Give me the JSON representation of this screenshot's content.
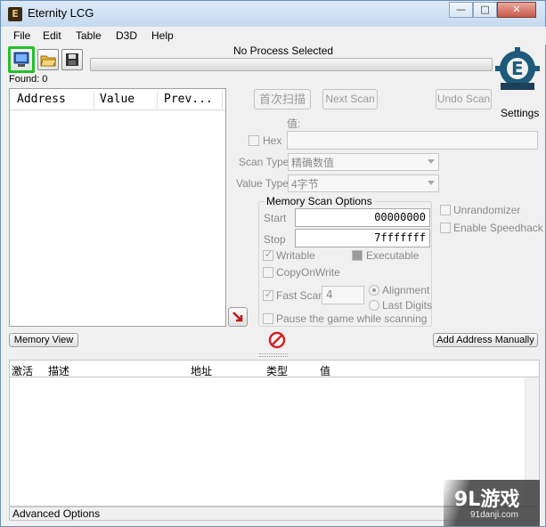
{
  "window": {
    "title": "Eternity LCG",
    "controls": {
      "minimize": "—",
      "maximize": "□",
      "close": "✕"
    }
  },
  "menu": [
    "File",
    "Edit",
    "Table",
    "D3D",
    "Help"
  ],
  "process": {
    "label": "No Process Selected",
    "progress": 0
  },
  "found": "Found: 0",
  "settings_label": "Settings",
  "scan_list": {
    "columns": [
      "Address",
      "Value",
      "Prev..."
    ]
  },
  "scan_buttons": {
    "first": "首次扫描",
    "next": "Next Scan",
    "undo": "Undo Scan"
  },
  "value": {
    "label": "值:",
    "hex_label": "Hex",
    "input": ""
  },
  "scan_type": {
    "label": "Scan Type",
    "selected": "精确数值"
  },
  "value_type": {
    "label": "Value Type",
    "selected": "4字节"
  },
  "memory_options": {
    "title": "Memory Scan Options",
    "start_label": "Start",
    "start_value": "00000000",
    "stop_label": "Stop",
    "stop_value": "7fffffff",
    "writable": "Writable",
    "executable": "Executable",
    "copy_on_write": "CopyOnWrite",
    "fast_scan": "Fast Scan",
    "fast_scan_value": "4",
    "alignment": "Alignment",
    "last_digits": "Last Digits",
    "pause": "Pause the game while scanning"
  },
  "side_options": {
    "unrandomizer": "Unrandomizer",
    "speedhack": "Enable Speedhack"
  },
  "memory_view": "Memory View",
  "add_address": "Add Address Manually",
  "address_table": {
    "columns": [
      "激活",
      "描述",
      "地址",
      "类型",
      "值"
    ]
  },
  "status_bar": "Advanced Options",
  "watermark": {
    "logo": "9L游戏",
    "url": "91danji.com"
  },
  "colors": {
    "accent_green": "#22c12a",
    "title_bg": "#c6daee",
    "stop_red": "#d62020"
  }
}
